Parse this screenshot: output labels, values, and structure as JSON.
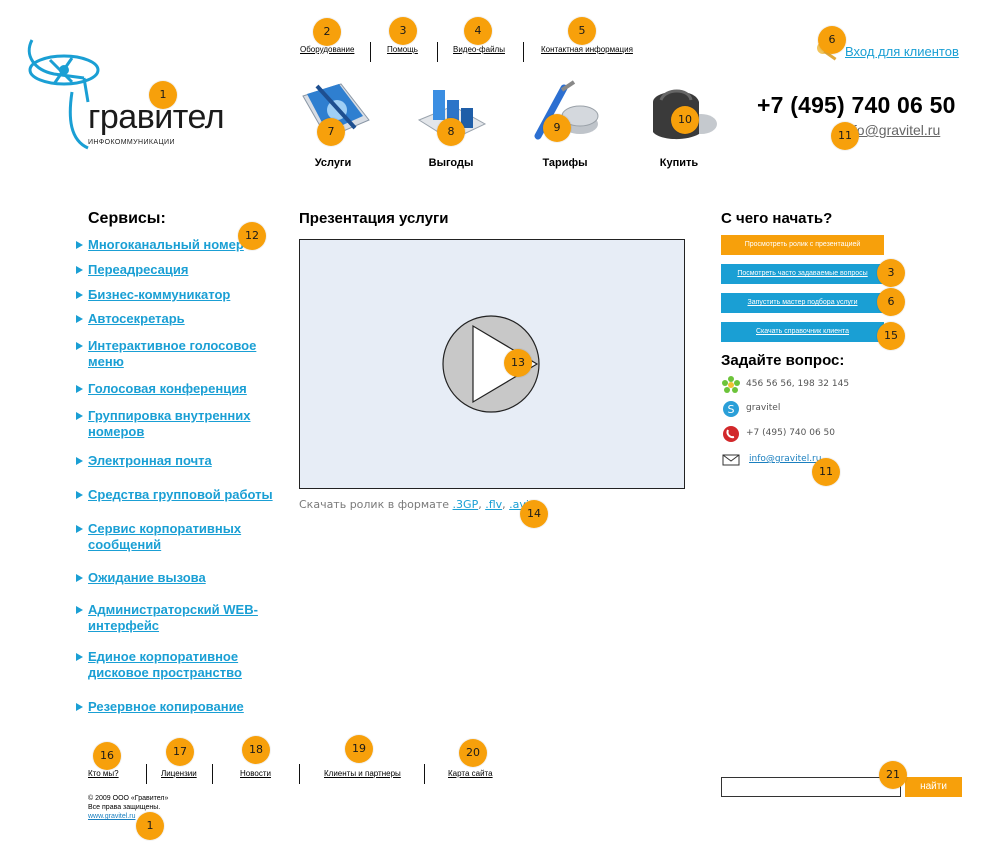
{
  "header": {
    "nav": [
      {
        "label": "Оборудование"
      },
      {
        "label": "Помощь"
      },
      {
        "label": "Видео-файлы"
      },
      {
        "label": "Контактная информация"
      }
    ],
    "login_label": "Вход для клиентов",
    "phone": "+7 (495) 740 06 50",
    "email": "info@gravitel.ru"
  },
  "logo": {
    "name": "гравител",
    "subtitle": "ИНФОКОММУНИКАЦИИ"
  },
  "categories": [
    {
      "label": "Услуги",
      "icon": "book-icon"
    },
    {
      "label": "Выгоды",
      "icon": "bar-chart-icon"
    },
    {
      "label": "Тарифы",
      "icon": "tools-coins-icon"
    },
    {
      "label": "Купить",
      "icon": "wallet-icon"
    }
  ],
  "sidebar": {
    "title": "Сервисы:",
    "items": [
      {
        "line1": "Многоканальный номер",
        "line2": ""
      },
      {
        "line1": "Переадресация",
        "line2": ""
      },
      {
        "line1": "Бизнес-коммуникатор",
        "line2": ""
      },
      {
        "line1": "Автосекретарь",
        "line2": ""
      },
      {
        "line1": "Интерактивное голосовое",
        "line2": "меню"
      },
      {
        "line1": "Голосовая конференция",
        "line2": ""
      },
      {
        "line1": "Группировка внутренних",
        "line2": "номеров"
      },
      {
        "line1": "Электронная почта",
        "line2": ""
      },
      {
        "line1": "Средства групповой работы",
        "line2": ""
      },
      {
        "line1": "Сервис корпоративных",
        "line2": "сообщений"
      },
      {
        "line1": "Ожидание вызова",
        "line2": ""
      },
      {
        "line1": "Администраторский WEB-",
        "line2": "интерфейс"
      },
      {
        "line1": "Единое корпоративное",
        "line2": "дисковое пространство"
      },
      {
        "line1": "Резервное копирование",
        "line2": ""
      }
    ]
  },
  "presentation": {
    "title": "Презентация услуги",
    "download_prefix": "Скачать ролик в формате",
    "formats": [
      ".3GP",
      ".flv",
      ".avi"
    ],
    "sep": ","
  },
  "start": {
    "title": "С чего начать?",
    "buttons": [
      {
        "label": "Просмотреть ролик с презентацией"
      },
      {
        "label": "Посмотреть часто задаваемые вопросы"
      },
      {
        "label": "Запустить мастер подбора услуги"
      },
      {
        "label": "Скачать справочник клиента"
      }
    ]
  },
  "ask": {
    "title": "Задайте вопрос:",
    "contacts": [
      {
        "icon": "icq-icon",
        "text": "456 56 56, 198 32 145"
      },
      {
        "icon": "skype-icon",
        "text": "gravitel"
      },
      {
        "icon": "phone-icon",
        "text": "+7 (495) 740 06 50"
      },
      {
        "icon": "envelope-icon",
        "text": "info@gravitel.ru"
      }
    ]
  },
  "footer": {
    "nav": [
      {
        "label": "Кто мы?"
      },
      {
        "label": "Лицензии"
      },
      {
        "label": "Новости"
      },
      {
        "label": "Клиенты и партнеры"
      },
      {
        "label": "Карта сайта"
      }
    ],
    "copyright": "© 2009 ООО «Гравител»",
    "rights": "Все права защищены.",
    "site": "www.gravitel.ru"
  },
  "search": {
    "value": "",
    "button": "найти"
  },
  "markers": [
    "1",
    "2",
    "3",
    "4",
    "5",
    "6",
    "7",
    "8",
    "9",
    "10",
    "11",
    "12",
    "13",
    "14",
    "15",
    "16",
    "17",
    "18",
    "19",
    "20",
    "21"
  ],
  "colors": {
    "accent_orange": "#f7a00b",
    "link_blue": "#1a9fd4",
    "video_bg": "#e7edf6"
  }
}
